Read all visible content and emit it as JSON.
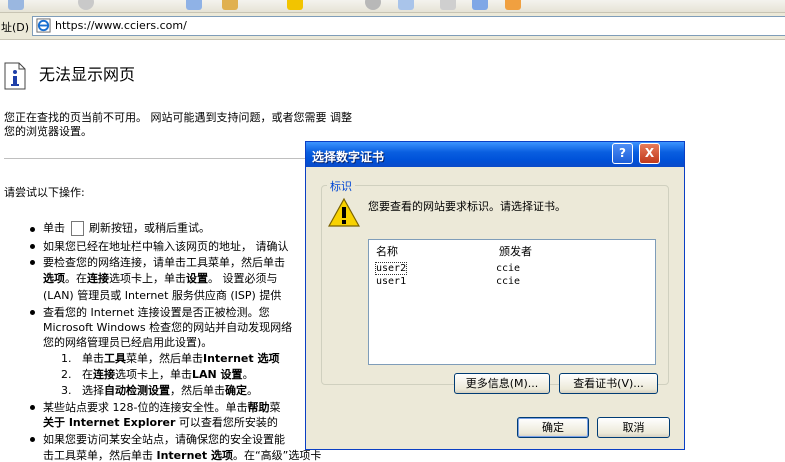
{
  "address_bar": {
    "label": "址(D)",
    "url": "https://www.cciers.com/"
  },
  "page": {
    "title": "无法显示网页",
    "intro_line1": "您正在查找的页当前不可用。 网站可能遇到支持问题，或者您需要 调整",
    "intro_line2": "您的浏览器设置。",
    "try_heading": "请尝试以下操作:",
    "b1_pre": "单击",
    "b1_post": "刷新按钮，或稍后重试。",
    "b2": "如果您已经在地址栏中输入该网页的地址， 请确认",
    "b3_l1": "要检查您的网络连接，请单击工具菜单，然后单击",
    "b3_l2a": "选项",
    "b3_l2b": "。在",
    "b3_l2c": "连接",
    "b3_l2d": "选项卡上，单击",
    "b3_l2e": "设置",
    "b3_l2f": "。 设置必须与",
    "b3_l3": "(LAN) 管理员或 Internet 服务供应商 (ISP) 提供",
    "b4_l1": "查看您的 Internet 连接设置是否正被检测。您",
    "b4_l2": "Microsoft Windows 检查您的网站并自动发现网络",
    "b4_l3": "您的网络管理员已经启用此设置)。",
    "s1_num": "1.",
    "s1a": "单击",
    "s1b": "工具",
    "s1c": "菜单，然后单击",
    "s1d": "Internet 选项",
    "s2_num": "2.",
    "s2a": "在",
    "s2b": "连接",
    "s2c": "选项卡上，单击",
    "s2d": "LAN 设置",
    "s2e": "。",
    "s3_num": "3.",
    "s3a": "选择",
    "s3b": "自动检测设置",
    "s3c": "，然后单击",
    "s3d": "确定",
    "s3e": "。",
    "b5_l1a": "某些站点要求 128-位的连接安全性。单击",
    "b5_l1b": "帮助",
    "b5_l1c": "菜",
    "b5_l2a": "关于 Internet Explorer",
    "b5_l2b": " 可以查看您所安装的",
    "b6_l1": "如果您要访问某安全站点，请确保您的安全设置能",
    "b6_l2a": "击工具菜单，然后单击 ",
    "b6_l2b": "Internet 选项",
    "b6_l2c": "。在“高级”选项卡"
  },
  "dialog": {
    "title": "选择数字证书",
    "help_label": "?",
    "close_label": "X",
    "group_title": "标识",
    "prompt": "您要查看的网站要求标识。请选择证书。",
    "columns": [
      "名称",
      "颁发者"
    ],
    "rows": [
      {
        "name": "user2",
        "issuer": "ccie"
      },
      {
        "name": "user1",
        "issuer": "ccie"
      }
    ],
    "more_info": "更多信息(M)...",
    "view_cert": "查看证书(V)...",
    "ok": "确定",
    "cancel": "取消"
  }
}
